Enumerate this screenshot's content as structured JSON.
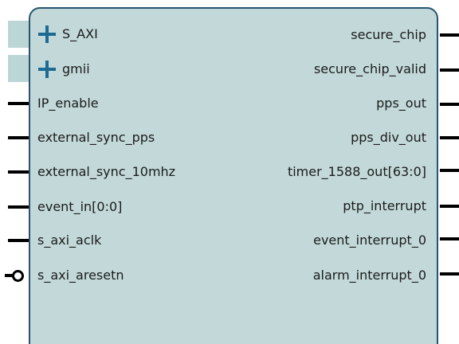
{
  "block": {
    "left_ports": [
      {
        "label": "S_AXI",
        "kind": "bus"
      },
      {
        "label": "gmii",
        "kind": "bus"
      },
      {
        "label": "IP_enable",
        "kind": "pin"
      },
      {
        "label": "external_sync_pps",
        "kind": "pin"
      },
      {
        "label": "external_sync_10mhz",
        "kind": "pin"
      },
      {
        "label": "event_in[0:0]",
        "kind": "pin"
      },
      {
        "label": "s_axi_aclk",
        "kind": "pin"
      },
      {
        "label": "s_axi_aresetn",
        "kind": "active-low-pin"
      }
    ],
    "right_ports": [
      {
        "label": "secure_chip"
      },
      {
        "label": "secure_chip_valid"
      },
      {
        "label": "pps_out"
      },
      {
        "label": "pps_div_out"
      },
      {
        "label": "timer_1588_out[63:0]"
      },
      {
        "label": "ptp_interrupt"
      },
      {
        "label": "event_interrupt_0"
      },
      {
        "label": "alarm_interrupt_0"
      }
    ]
  },
  "colors": {
    "block_fill": "#c3d9d9",
    "block_border": "#285470",
    "bus_icon": "#1d6a93",
    "pin": "#000000"
  },
  "icons": {
    "bus_expand": "plus-icon",
    "active_low": "inversion-bubble-icon"
  }
}
